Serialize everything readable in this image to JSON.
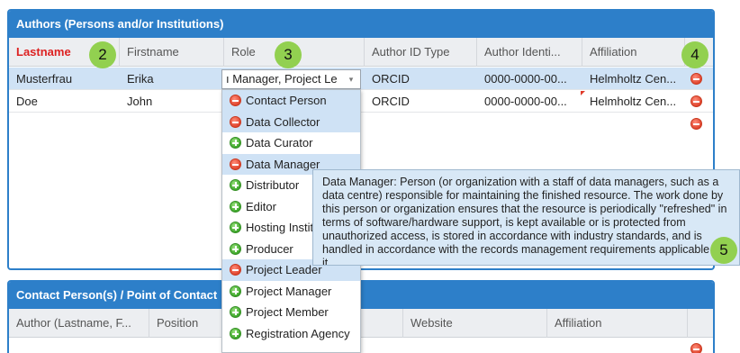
{
  "authors_panel": {
    "title": "Authors (Persons and/or Institutions)",
    "columns": [
      "Lastname",
      "Firstname",
      "Role",
      "Author ID Type",
      "Author Identi...",
      "Affiliation"
    ],
    "rows": [
      {
        "lastname": "Musterfrau",
        "firstname": "Erika",
        "role": "ı Manager, Project Le",
        "id_type": "ORCID",
        "identifier": "0000-0000-00...",
        "affiliation": "Helmholtz Cen..."
      },
      {
        "lastname": "Doe",
        "firstname": "John",
        "role": "",
        "id_type": "ORCID",
        "identifier": "0000-0000-00...",
        "affiliation": "Helmholtz Cen..."
      }
    ]
  },
  "role_dropdown": {
    "arrow": "▾",
    "items": [
      {
        "label": "Contact Person",
        "selected": true
      },
      {
        "label": "Data Collector",
        "selected": true
      },
      {
        "label": "Data Curator",
        "selected": false
      },
      {
        "label": "Data Manager",
        "selected": true
      },
      {
        "label": "Distributor",
        "selected": false
      },
      {
        "label": "Editor",
        "selected": false
      },
      {
        "label": "Hosting Instituti",
        "selected": false
      },
      {
        "label": "Producer",
        "selected": false
      },
      {
        "label": "Project Leader",
        "selected": true
      },
      {
        "label": "Project Manager",
        "selected": false
      },
      {
        "label": "Project Member",
        "selected": false
      },
      {
        "label": "Registration Agency",
        "selected": false
      }
    ]
  },
  "tooltip": {
    "text": "Data Manager: Person (or organization with a staff of data managers, such as a data centre) responsible for maintaining the finished resource. The work done by this person or organization ensures that the resource is periodically \"refreshed\" in terms of software/hardware support, is kept available or is protected from unauthorized access, is stored in accordance with industry standards, and is handled in accordance with the records management requirements applicable to it."
  },
  "contacts_panel": {
    "title": "Contact Person(s) / Point of Contact",
    "columns": [
      "Author (Lastname, F...",
      "Position",
      "Website",
      "Affiliation"
    ]
  },
  "badges": [
    "2",
    "3",
    "4",
    "5"
  ],
  "icons": {
    "remove": "remove-row-icon",
    "add": "add-role-icon"
  },
  "colors": {
    "header_blue": "#2d7fc9",
    "required_red": "#dd2222",
    "selection_blue": "#cfe2f5",
    "badge_green": "#92d050",
    "tooltip_bg": "#d8e8f6"
  }
}
